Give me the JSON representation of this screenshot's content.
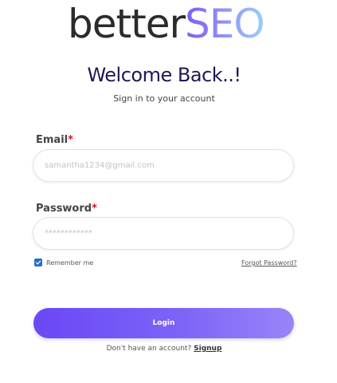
{
  "logo": {
    "part1": "better",
    "part2": "SEO"
  },
  "header": {
    "title": "Welcome Back..!",
    "subtitle": "Sign in to your account"
  },
  "form": {
    "email": {
      "label": "Email",
      "required_mark": "*",
      "placeholder": "samantha1234@gmail.com"
    },
    "password": {
      "label": "Password",
      "required_mark": "*",
      "placeholder": "************"
    },
    "remember_label": "Remember me",
    "remember_checked": true,
    "forgot_label": "Forgot Password?",
    "login_label": "Login"
  },
  "footer": {
    "prompt": "Don't have an account?",
    "signup_label": "Signup"
  },
  "colors": {
    "brand_purple": "#6a48f6",
    "title_navy": "#1f1854",
    "required_red": "#d1142c",
    "checkbox_blue": "#1f6fd6"
  }
}
